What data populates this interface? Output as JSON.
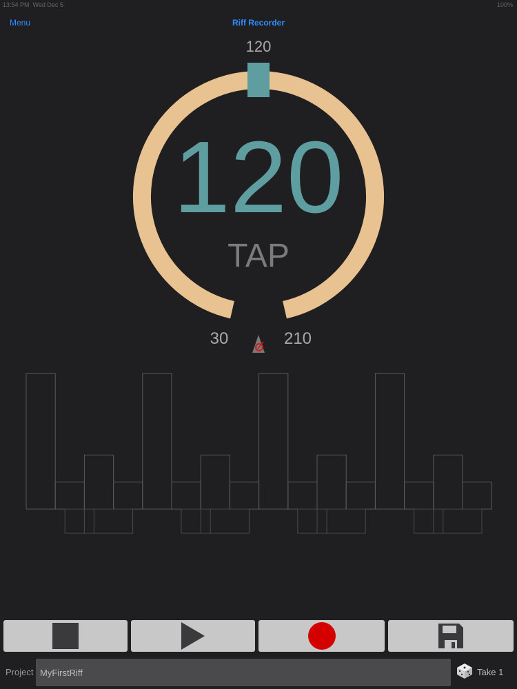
{
  "status_bar": {
    "time": "13:54 PM",
    "date": "Wed Dec 5",
    "battery": "100%"
  },
  "nav": {
    "menu_label": "Menu",
    "title": "Riff Recorder"
  },
  "tempo": {
    "current_bpm": "120",
    "bpm_big": "120",
    "tap_label": "TAP",
    "min_bpm": "30",
    "max_bpm": "210",
    "dial_fraction": 0.5
  },
  "colors": {
    "background": "#1f1f21",
    "dial_ring": "#e8c290",
    "accent_teal": "#5f9ea0",
    "link_blue": "#2f8cff",
    "record_red": "#d40000",
    "button_gray": "#c8c8c8"
  },
  "icons": {
    "metronome": "metronome-icon",
    "stop": "stop-icon",
    "play": "play-icon",
    "record": "record-icon",
    "save": "floppy-disk-icon",
    "dice": "dice-icon"
  },
  "beat_pattern": {
    "levels": [
      3,
      1,
      2,
      1,
      3,
      1,
      2,
      1,
      3,
      1,
      2,
      1,
      3,
      1,
      2,
      1
    ],
    "sub_rows": [
      false,
      true,
      true,
      false,
      false,
      true,
      true,
      false,
      false,
      true,
      true,
      false,
      false,
      true,
      true,
      false
    ]
  },
  "controls": {
    "stop": "stop",
    "play": "play",
    "record": "record",
    "save": "save"
  },
  "project": {
    "label": "Project",
    "name": "MyFirstRiff",
    "take_label": "Take",
    "take_number": "1"
  }
}
